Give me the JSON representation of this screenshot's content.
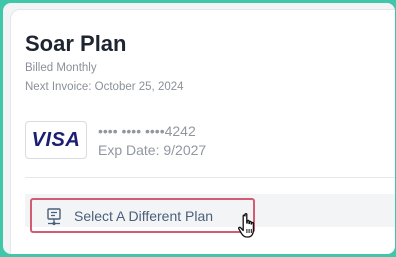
{
  "plan": {
    "name": "Soar Plan",
    "billing_frequency": "Billed Monthly",
    "next_invoice": "Next Invoice: October 25, 2024"
  },
  "payment": {
    "brand": "VISA",
    "masked_number": "•••• •••• ••••4242",
    "expiry": "Exp Date: 9/2027"
  },
  "actions": {
    "select_plan_label": "Select A Different Plan",
    "select_plan_icon": "plan-selector-icon"
  },
  "colors": {
    "page_background": "#40c7a9",
    "highlight_border": "#d25c73",
    "visa_blue": "#1a1f71",
    "action_text": "#4a5f7a"
  }
}
